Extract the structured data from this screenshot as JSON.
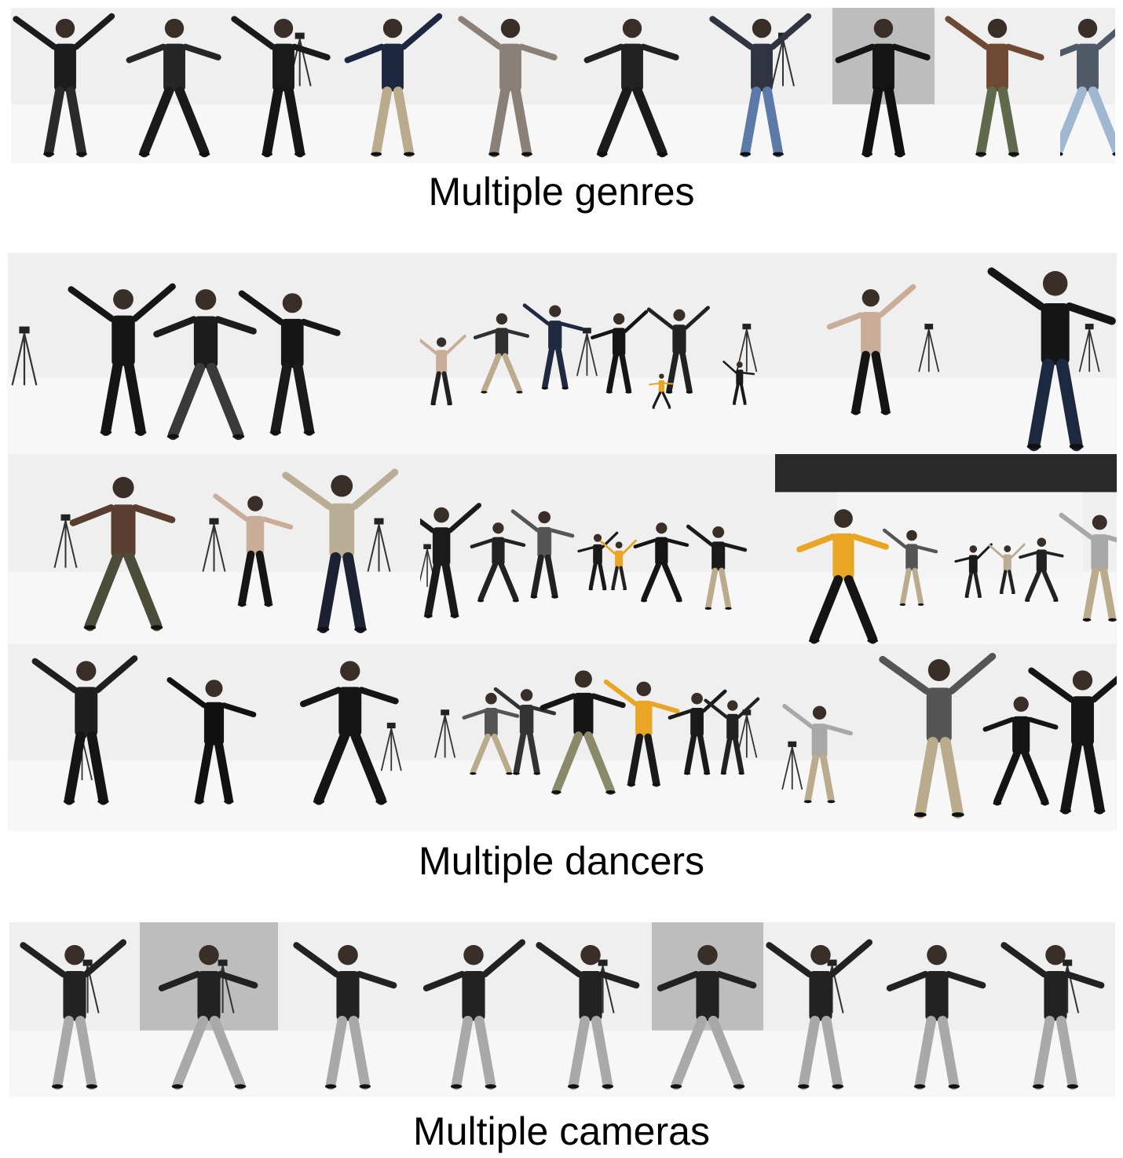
{
  "captions": {
    "genres": "Multiple genres",
    "dancers": "Multiple dancers",
    "cameras": "Multiple cameras"
  },
  "panels": {
    "genres": {
      "count": 10
    },
    "dancers": {
      "rows": 3,
      "cols": 3
    },
    "cameras": {
      "count": 9
    }
  },
  "colors": {
    "studio_bg": "#efefef",
    "floor": "#f7f7f7",
    "dark_clothing": "#1c1c1c",
    "yellow_hoodie": "#e8a624",
    "grey_pants": "#a9a9a9",
    "khaki_pants": "#b9ab8c",
    "stage_curtain": "#2a2a2a"
  }
}
